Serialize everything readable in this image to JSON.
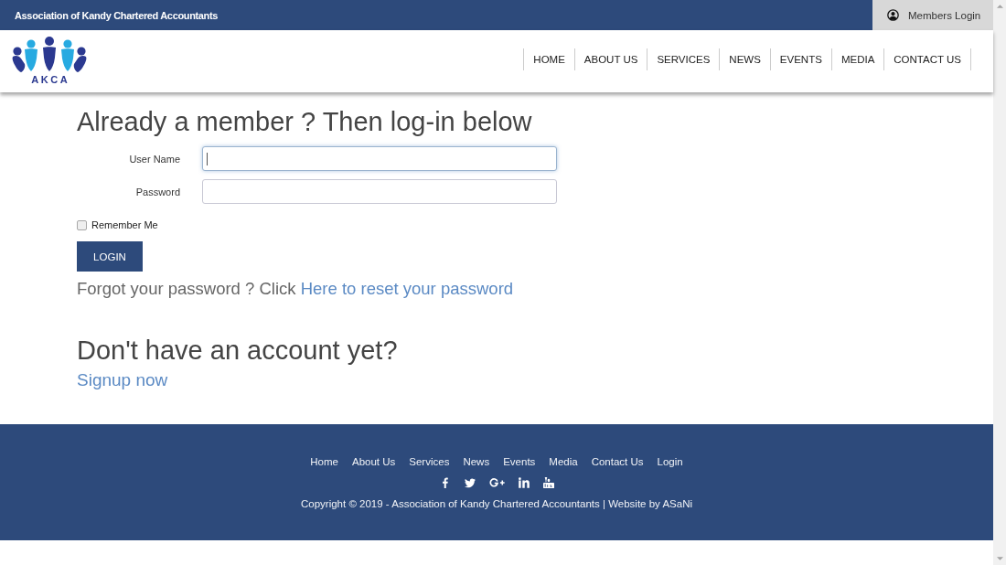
{
  "top_bar": {
    "title": "Association of Kandy Chartered Accountants",
    "members_login": "Members Login"
  },
  "header": {
    "logo_text": "AKCA",
    "nav": [
      {
        "label": "HOME"
      },
      {
        "label": "ABOUT US"
      },
      {
        "label": "SERVICES"
      },
      {
        "label": "NEWS"
      },
      {
        "label": "EVENTS"
      },
      {
        "label": "MEDIA"
      },
      {
        "label": "CONTACT US"
      }
    ]
  },
  "login": {
    "heading": "Already a member ? Then log-in below",
    "fields": [
      {
        "label": "User Name",
        "focused": true
      },
      {
        "label": "Password",
        "focused": false
      }
    ],
    "remember": {
      "label": "Remember Me",
      "checked": false
    },
    "button": "LOGIN",
    "forgot": {
      "text": "Forgot your password ? Click",
      "link": "Here to reset your password"
    }
  },
  "signup": {
    "heading": "Don't have an account yet?",
    "link": "Signup now"
  },
  "footer": {
    "links": [
      "Home",
      "About Us",
      "Services",
      "News",
      "Events",
      "Media",
      "Contact Us",
      "Login"
    ],
    "social": [
      {
        "kind": "facebook"
      },
      {
        "kind": "twitter"
      },
      {
        "kind": "googleplus"
      },
      {
        "kind": "linkedin"
      },
      {
        "kind": "youtube"
      }
    ],
    "copyright": "Copyright © 2019 - Association of Kandy Chartered Accountants | Website by ASaNi"
  }
}
